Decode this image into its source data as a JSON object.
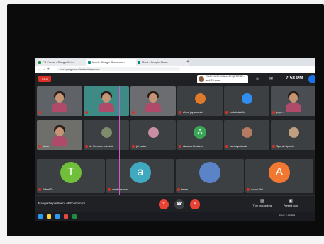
{
  "browser": {
    "tabs": [
      {
        "label": "PB Forms - Google Drive"
      },
      {
        "label": "Meet - Google Classroom"
      },
      {
        "label": "Meet - Google Class"
      }
    ],
    "new_tab": "+",
    "url": "meet.google.com/lookup/classroom"
  },
  "meet": {
    "rec_label": "REC",
    "presenter": "RAJKHUSH MALLICK (PRESE...",
    "presenter_sub": "and 33 more",
    "time": "7:58 PM",
    "meeting_name": "Nanga Department of Economics",
    "controls": {
      "mic_icon": "mic-off-icon",
      "hangup_icon": "hangup-icon",
      "camera_icon": "camera-off-icon"
    },
    "right_controls": [
      {
        "label": "Turn on captions",
        "icon": "captions-icon"
      },
      {
        "label": "Present now",
        "icon": "present-icon"
      }
    ]
  },
  "participants": [
    {
      "name": "",
      "kind": "video",
      "color": "#5f6266"
    },
    {
      "name": "",
      "kind": "video",
      "color": "#3e8a84"
    },
    {
      "name": "",
      "kind": "video",
      "color": "#6b6d70"
    },
    {
      "name": "afrina jaysatomah",
      "kind": "photo",
      "color": "#3c4043",
      "photo": "#e07a2b"
    },
    {
      "name": "imdabalvat lio",
      "kind": "photo",
      "color": "#3c4043",
      "photo": "#2f8ef0"
    },
    {
      "name": "prya...",
      "kind": "video",
      "color": "#4a4d52"
    },
    {
      "name": "athub",
      "kind": "video",
      "color": "#6e6e6a"
    },
    {
      "name": "dr. bheshan cdienbde",
      "kind": "photo",
      "color": "#3c4043",
      "photo": "#7e8c6c"
    },
    {
      "name": "jal yadav",
      "kind": "photo",
      "color": "#3c4043",
      "photo": "#c78ea4"
    },
    {
      "name": "Akasora Bhatana",
      "kind": "letter",
      "letter": "A",
      "color": "#3c4043",
      "avatar": "#3aa757"
    },
    {
      "name": "raminiya bhusk",
      "kind": "photo",
      "color": "#3c4043",
      "photo": "#b57a62"
    },
    {
      "name": "Sparsh Sparsh",
      "kind": "photo",
      "color": "#3c4043",
      "photo": "#c0a080"
    },
    {
      "name": "Tufeel Te",
      "kind": "letter",
      "letter": "T",
      "color": "#3c4043",
      "avatar": "#6fbf3a",
      "big": true
    },
    {
      "name": "amithra sarkar",
      "kind": "letter",
      "letter": "a",
      "color": "#3c4043",
      "avatar": "#40a9c0",
      "big": true
    },
    {
      "name": "beam t",
      "kind": "photo",
      "color": "#3c4043",
      "photo": "#5a83c8",
      "big": true
    },
    {
      "name": "Ananh Pal",
      "kind": "letter",
      "letter": "A",
      "color": "#3c4043",
      "avatar": "#f27730",
      "big": true
    }
  ],
  "taskbar": {
    "text": "ENG 7:58 PM"
  }
}
